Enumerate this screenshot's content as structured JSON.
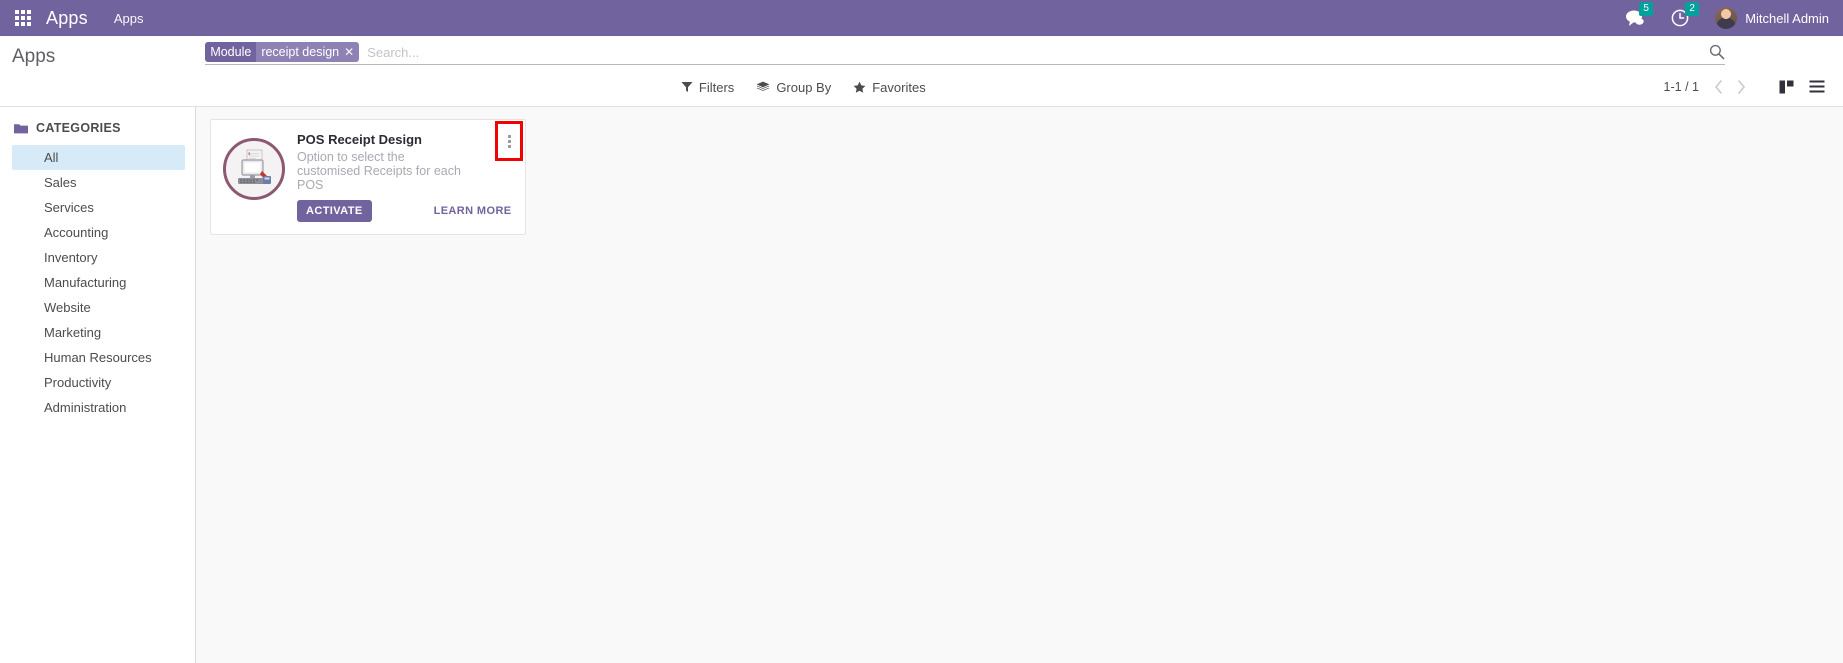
{
  "navbar": {
    "apps_grid_icon": "grid-apps-icon",
    "brand": "Apps",
    "menu_item": "Apps",
    "messages_icon": "chat-bubble-icon",
    "messages_count": "5",
    "activities_icon": "clock-icon",
    "activities_count": "2",
    "avatar_icon": "user-avatar",
    "user_name": "Mitchell Admin",
    "background_color": "#71639e"
  },
  "control_panel": {
    "breadcrumb": "Apps",
    "search": {
      "facet_label": "Module",
      "facet_value": "receipt design",
      "facet_remove_icon": "close-icon",
      "placeholder": "Search...",
      "value": "",
      "magnifier_icon": "search-icon"
    },
    "buttons": [
      {
        "label": "Filters",
        "icon": "funnel-icon"
      },
      {
        "label": "Group By",
        "icon": "layers-icon"
      },
      {
        "label": "Favorites",
        "icon": "star-icon"
      }
    ],
    "pager": {
      "range": "1-1 / 1",
      "prev_icon": "chevron-left-icon",
      "next_icon": "chevron-right-icon"
    },
    "view_switcher": [
      {
        "name": "kanban",
        "icon": "kanban-icon",
        "active": true
      },
      {
        "name": "list",
        "icon": "list-icon",
        "active": false
      }
    ]
  },
  "sidebar": {
    "header": "CATEGORIES",
    "header_icon": "folder-icon",
    "items": [
      {
        "label": "All",
        "active": true
      },
      {
        "label": "Sales",
        "active": false
      },
      {
        "label": "Services",
        "active": false
      },
      {
        "label": "Accounting",
        "active": false
      },
      {
        "label": "Inventory",
        "active": false
      },
      {
        "label": "Manufacturing",
        "active": false
      },
      {
        "label": "Website",
        "active": false
      },
      {
        "label": "Marketing",
        "active": false
      },
      {
        "label": "Human Resources",
        "active": false
      },
      {
        "label": "Productivity",
        "active": false
      },
      {
        "label": "Administration",
        "active": false
      }
    ]
  },
  "apps": [
    {
      "title": "POS Receipt Design",
      "description": "Option to select the customised Receipts for each POS",
      "activate_label": "ACTIVATE",
      "learn_more_label": "LEARN MORE",
      "menu_icon": "vertical-ellipsis-icon",
      "icon": "pos-terminal-icon",
      "icon_ring_color": "#8d5970"
    }
  ],
  "colors": {
    "brand_purple": "#71639e",
    "badge_green": "#00a09d",
    "selected_blue": "#d6eaf8",
    "highlight_red": "#f50000",
    "content_bg": "#f9f9f9"
  }
}
